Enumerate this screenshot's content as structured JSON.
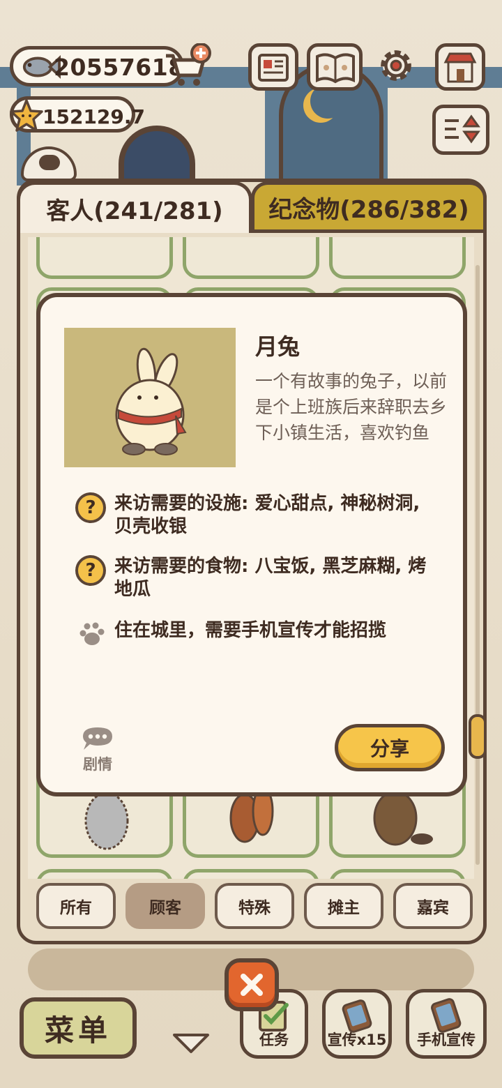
{
  "hud": {
    "fish_currency": "20557618",
    "star_currency": "152129.7",
    "icons": [
      "fish-icon",
      "cart-plus-icon",
      "star-icon",
      "notes-icon",
      "paw-book-icon",
      "gear-icon",
      "shop-icon",
      "sort-icon"
    ]
  },
  "tabs": {
    "guests": "客人(241/281)",
    "souvenirs": "纪念物(286/382)",
    "active": "guests"
  },
  "detail": {
    "name": "月兔",
    "description": "一个有故事的兔子，以前是个上班族后来辞职去乡下小镇生活，喜欢钓鱼",
    "requirement_facility": "来访需要的设施: 爱心甜点, 神秘树洞, 贝壳收银",
    "requirement_food": "来访需要的食物: 八宝饭, 黑芝麻糊, 烤地瓜",
    "habitat": "住在城里，需要手机宣传才能招揽",
    "question_mark": "?",
    "story_label": "剧情",
    "share_label": "分享"
  },
  "filters": [
    {
      "label": "所有",
      "active": false
    },
    {
      "label": "顾客",
      "active": true
    },
    {
      "label": "特殊",
      "active": false
    },
    {
      "label": "摊主",
      "active": false
    },
    {
      "label": "嘉宾",
      "active": false
    }
  ],
  "bottom_bar": {
    "menu_label": "菜单",
    "task_label": "任务",
    "promo_label": "宣传x15",
    "phone_promo_label": "手机宣传"
  },
  "colors": {
    "outline": "#5a4436",
    "panel": "#e8dcc6",
    "popup": "#fdf7ee",
    "accent_yellow": "#f6c54a",
    "souvenir_tab": "#c9a834",
    "card_border": "#8fa56a",
    "close_red": "#e2662e"
  }
}
